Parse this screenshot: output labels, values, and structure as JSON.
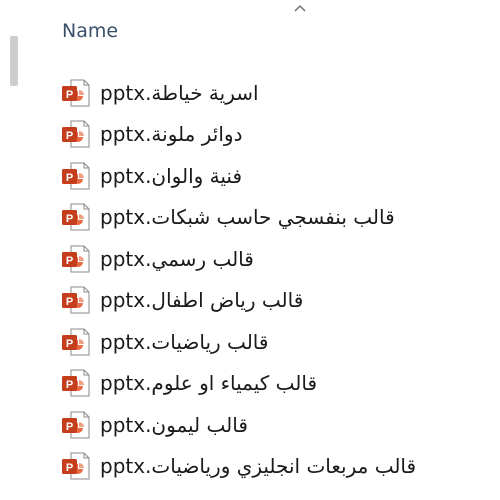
{
  "header": {
    "name_label": "Name",
    "sort_icon": "chevron-up-icon"
  },
  "files": [
    {
      "name": "اسرية خياطة.pptx",
      "icon": "powerpoint-file-icon"
    },
    {
      "name": "دوائر ملونة.pptx",
      "icon": "powerpoint-file-icon"
    },
    {
      "name": "فنية والوان.pptx",
      "icon": "powerpoint-file-icon"
    },
    {
      "name": "قالب بنفسجي حاسب شبكات.pptx",
      "icon": "powerpoint-file-icon"
    },
    {
      "name": "قالب رسمي.pptx",
      "icon": "powerpoint-file-icon"
    },
    {
      "name": "قالب رياض اطفال.pptx",
      "icon": "powerpoint-file-icon"
    },
    {
      "name": "قالب رياضيات.pptx",
      "icon": "powerpoint-file-icon"
    },
    {
      "name": "قالب كيمياء او علوم.pptx",
      "icon": "powerpoint-file-icon"
    },
    {
      "name": "قالب ليمون.pptx",
      "icon": "powerpoint-file-icon"
    },
    {
      "name": "قالب مربعات انجليزي ورياضيات.pptx",
      "icon": "powerpoint-file-icon"
    }
  ],
  "colors": {
    "header_text": "#3a4f6b",
    "icon_orange": "#d35230",
    "icon_red": "#b7472a"
  }
}
